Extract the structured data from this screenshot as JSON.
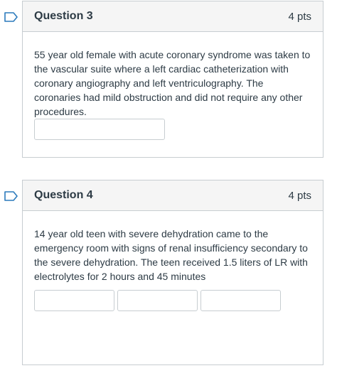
{
  "questions": [
    {
      "title": "Question 3",
      "points": "4 pts",
      "text": "55 year old female with acute coronary syndrome was taken to the  vascular suite where a left cardiac catheterization with coronary angiography and left ventriculography. The coronaries had mild obstruction and did not require any other procedures.",
      "answer_value": ""
    },
    {
      "title": "Question 4",
      "points": "4 pts",
      "text": "14 year old teen with severe dehydration came to the emergency room with signs of renal insufficiency secondary to the severe dehydration. The teen received 1.5 liters of LR with electrolytes for 2 hours and 45 minutes",
      "answer_values": [
        "",
        "",
        ""
      ]
    }
  ],
  "colors": {
    "flag_stroke": "#2b7abc",
    "border": "#c7cdd1",
    "header_bg": "#f5f5f5",
    "text": "#2d3b45"
  },
  "icons": {
    "flag": "bookmark-flag-icon"
  }
}
